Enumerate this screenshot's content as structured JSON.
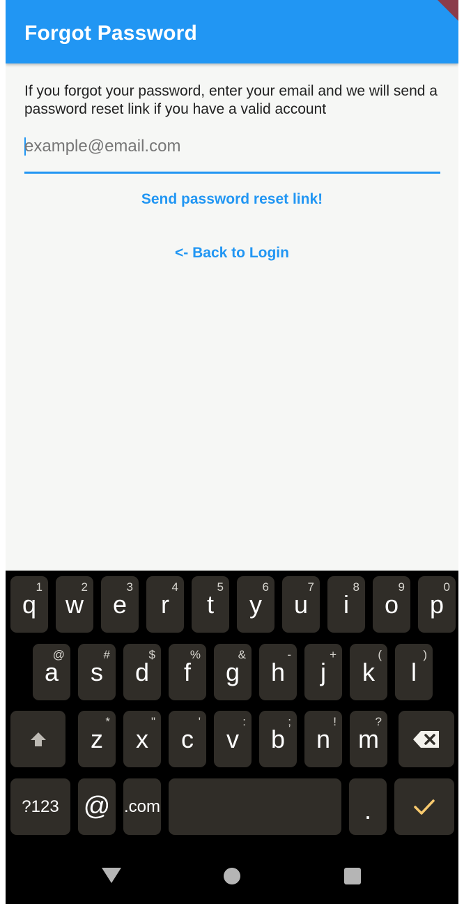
{
  "appbar": {
    "title": "Forgot Password"
  },
  "intro": "If you forgot your password, enter your email and we will send a password reset link if you have a valid account",
  "email": {
    "value": "",
    "placeholder": "example@email.com"
  },
  "actions": {
    "send_label": "Send password reset link!",
    "back_label": "<- Back to Login"
  },
  "keyboard": {
    "row1": [
      {
        "key": "q",
        "hint": "1"
      },
      {
        "key": "w",
        "hint": "2"
      },
      {
        "key": "e",
        "hint": "3"
      },
      {
        "key": "r",
        "hint": "4"
      },
      {
        "key": "t",
        "hint": "5"
      },
      {
        "key": "y",
        "hint": "6"
      },
      {
        "key": "u",
        "hint": "7"
      },
      {
        "key": "i",
        "hint": "8"
      },
      {
        "key": "o",
        "hint": "9"
      },
      {
        "key": "p",
        "hint": "0"
      }
    ],
    "row2": [
      {
        "key": "a",
        "hint": "@"
      },
      {
        "key": "s",
        "hint": "#"
      },
      {
        "key": "d",
        "hint": "$"
      },
      {
        "key": "f",
        "hint": "%"
      },
      {
        "key": "g",
        "hint": "&"
      },
      {
        "key": "h",
        "hint": "-"
      },
      {
        "key": "j",
        "hint": "+"
      },
      {
        "key": "k",
        "hint": "("
      },
      {
        "key": "l",
        "hint": ")"
      }
    ],
    "row3": [
      {
        "key": "z",
        "hint": "*"
      },
      {
        "key": "x",
        "hint": "\""
      },
      {
        "key": "c",
        "hint": "'"
      },
      {
        "key": "v",
        "hint": ":"
      },
      {
        "key": "b",
        "hint": ";"
      },
      {
        "key": "n",
        "hint": "!"
      },
      {
        "key": "m",
        "hint": "?"
      }
    ],
    "symbols_label": "?123",
    "at_label": "@",
    "dotcom_label": ".com",
    "period_label": ".",
    "shift_icon": "shift-arrow-icon",
    "backspace_icon": "backspace-icon",
    "enter_icon": "check-icon"
  },
  "colors": {
    "appbar": "#2196f3",
    "accent": "#2196f3",
    "key_bg": "#302d28",
    "check": "#f7c96e"
  }
}
